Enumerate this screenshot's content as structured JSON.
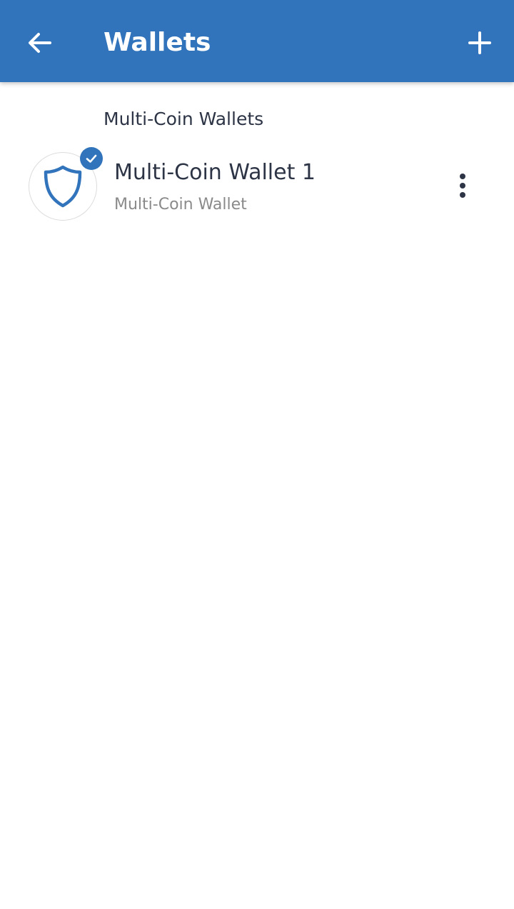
{
  "app_bar": {
    "title": "Wallets",
    "back_icon": "arrow-left-icon",
    "add_icon": "plus-icon",
    "background_color": "#3174bb"
  },
  "section": {
    "header": "Multi-Coin Wallets"
  },
  "wallets": [
    {
      "name": "Multi-Coin Wallet 1",
      "type": "Multi-Coin Wallet",
      "icon": "shield-icon",
      "selected": true,
      "badge_icon": "check-icon",
      "menu_icon": "more-vertical-icon"
    }
  ]
}
